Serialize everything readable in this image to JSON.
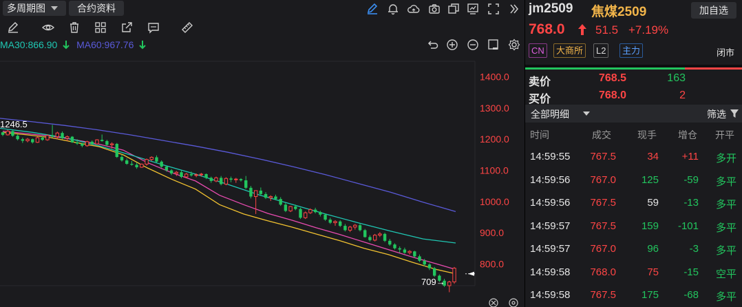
{
  "toolbar": {
    "period_label": "多周期图",
    "contract_label": "合约资料"
  },
  "ma_legend": [
    {
      "label": "MA30:866.90",
      "color": "#1fc7b3",
      "arrow": "down"
    },
    {
      "label": "MA60:967.76",
      "color": "#5a5ad9",
      "arrow": "down"
    }
  ],
  "annotations": {
    "high_label": "1246.5",
    "low_label": "709→"
  },
  "chart_data": {
    "type": "candlestick",
    "y_ticks": [
      "1400.0",
      "1300.0",
      "1200.0",
      "1100.0",
      "1000.0",
      "900.0",
      "800.0"
    ],
    "ylim": [
      730,
      1470
    ],
    "last_price": 768.0,
    "high": 1246.5,
    "low": 709,
    "candles": [
      [
        1222,
        1224,
        1210,
        1214
      ],
      [
        1214,
        1230,
        1212,
        1226
      ],
      [
        1226,
        1228,
        1208,
        1211
      ],
      [
        1211,
        1215,
        1196,
        1200
      ],
      [
        1200,
        1205,
        1188,
        1195
      ],
      [
        1195,
        1204,
        1190,
        1200
      ],
      [
        1200,
        1202,
        1186,
        1190
      ],
      [
        1190,
        1208,
        1188,
        1205
      ],
      [
        1205,
        1210,
        1195,
        1198
      ],
      [
        1198,
        1215,
        1195,
        1212
      ],
      [
        1212,
        1246,
        1205,
        1208
      ],
      [
        1208,
        1224,
        1200,
        1220
      ],
      [
        1220,
        1225,
        1200,
        1203
      ],
      [
        1203,
        1212,
        1194,
        1208
      ],
      [
        1208,
        1210,
        1188,
        1190
      ],
      [
        1190,
        1200,
        1182,
        1186
      ],
      [
        1186,
        1188,
        1174,
        1179
      ],
      [
        1179,
        1195,
        1176,
        1192
      ],
      [
        1192,
        1196,
        1182,
        1185
      ],
      [
        1185,
        1200,
        1183,
        1198
      ],
      [
        1198,
        1215,
        1192,
        1194
      ],
      [
        1194,
        1198,
        1178,
        1182
      ],
      [
        1182,
        1190,
        1170,
        1185
      ],
      [
        1185,
        1188,
        1140,
        1143
      ],
      [
        1143,
        1150,
        1128,
        1132
      ],
      [
        1132,
        1138,
        1118,
        1121
      ],
      [
        1121,
        1130,
        1115,
        1118
      ],
      [
        1118,
        1125,
        1105,
        1110
      ],
      [
        1110,
        1122,
        1108,
        1120
      ],
      [
        1120,
        1138,
        1115,
        1135
      ],
      [
        1135,
        1145,
        1130,
        1142
      ],
      [
        1142,
        1148,
        1125,
        1128
      ],
      [
        1128,
        1132,
        1108,
        1112
      ],
      [
        1112,
        1115,
        1096,
        1100
      ],
      [
        1100,
        1104,
        1085,
        1090
      ],
      [
        1090,
        1098,
        1082,
        1094
      ],
      [
        1094,
        1100,
        1075,
        1079
      ],
      [
        1079,
        1092,
        1075,
        1088
      ],
      [
        1088,
        1096,
        1080,
        1084
      ],
      [
        1084,
        1090,
        1078,
        1086
      ],
      [
        1086,
        1092,
        1080,
        1088
      ],
      [
        1088,
        1090,
        1072,
        1076
      ],
      [
        1076,
        1080,
        1060,
        1066
      ],
      [
        1066,
        1080,
        1062,
        1076
      ],
      [
        1076,
        1082,
        1052,
        1056
      ],
      [
        1056,
        1078,
        1052,
        1074
      ],
      [
        1074,
        1080,
        1062,
        1070
      ],
      [
        1070,
        1076,
        1060,
        1072
      ],
      [
        1072,
        1075,
        1064,
        1068
      ],
      [
        1068,
        1082,
        1040,
        1044
      ],
      [
        1044,
        1050,
        1010,
        1016
      ],
      [
        1016,
        1020,
        960,
        1035
      ],
      [
        1035,
        1045,
        1020,
        1024
      ],
      [
        1024,
        1030,
        1008,
        1012
      ],
      [
        1012,
        1020,
        1002,
        1016
      ],
      [
        1016,
        1022,
        1004,
        1008
      ],
      [
        1008,
        1014,
        986,
        990
      ],
      [
        990,
        996,
        966,
        970
      ],
      [
        970,
        986,
        966,
        984
      ],
      [
        984,
        990,
        972,
        976
      ],
      [
        976,
        980,
        944,
        948
      ],
      [
        948,
        968,
        944,
        964
      ],
      [
        964,
        978,
        960,
        974
      ],
      [
        974,
        980,
        962,
        966
      ],
      [
        966,
        970,
        952,
        958
      ],
      [
        958,
        962,
        938,
        942
      ],
      [
        942,
        948,
        928,
        932
      ],
      [
        932,
        940,
        922,
        936
      ],
      [
        936,
        940,
        918,
        922
      ],
      [
        922,
        928,
        904,
        908
      ],
      [
        908,
        922,
        902,
        918
      ],
      [
        918,
        928,
        910,
        924
      ],
      [
        924,
        930,
        904,
        908
      ],
      [
        908,
        912,
        884,
        886
      ],
      [
        886,
        892,
        872,
        876
      ],
      [
        876,
        896,
        872,
        892
      ],
      [
        892,
        902,
        886,
        896
      ],
      [
        896,
        900,
        870,
        874
      ],
      [
        874,
        880,
        858,
        862
      ],
      [
        862,
        866,
        846,
        850
      ],
      [
        850,
        856,
        836,
        846
      ],
      [
        846,
        852,
        832,
        836
      ],
      [
        836,
        844,
        830,
        840
      ],
      [
        840,
        842,
        820,
        824
      ],
      [
        824,
        830,
        806,
        810
      ],
      [
        810,
        816,
        792,
        798
      ],
      [
        798,
        802,
        780,
        786
      ],
      [
        786,
        790,
        758,
        762
      ],
      [
        762,
        766,
        742,
        746
      ],
      [
        746,
        752,
        726,
        730
      ],
      [
        730,
        746,
        709,
        742
      ],
      [
        742,
        790,
        736,
        786
      ]
    ],
    "ma_lines": [
      {
        "name": "MA5",
        "color": "#f2c230",
        "points": [
          [
            0,
            1222
          ],
          [
            10,
            1214
          ],
          [
            20,
            1205
          ],
          [
            30,
            1190
          ],
          [
            40,
            1176
          ],
          [
            50,
            1150
          ],
          [
            60,
            1108
          ],
          [
            70,
            1072
          ],
          [
            80,
            1040
          ],
          [
            90,
            990
          ],
          [
            100,
            960
          ],
          [
            110,
            938
          ],
          [
            120,
            918
          ],
          [
            130,
            896
          ],
          [
            140,
            874
          ],
          [
            150,
            850
          ],
          [
            160,
            830
          ],
          [
            170,
            805
          ],
          [
            180,
            782
          ],
          [
            188,
            768
          ]
        ]
      },
      {
        "name": "MA10",
        "color": "#e84bb0",
        "points": [
          [
            0,
            1226
          ],
          [
            10,
            1218
          ],
          [
            20,
            1210
          ],
          [
            30,
            1198
          ],
          [
            40,
            1184
          ],
          [
            50,
            1165
          ],
          [
            60,
            1125
          ],
          [
            70,
            1093
          ],
          [
            80,
            1066
          ],
          [
            90,
            1020
          ],
          [
            100,
            990
          ],
          [
            110,
            962
          ],
          [
            120,
            940
          ],
          [
            130,
            916
          ],
          [
            140,
            894
          ],
          [
            150,
            870
          ],
          [
            160,
            846
          ],
          [
            170,
            822
          ],
          [
            180,
            800
          ],
          [
            188,
            782
          ]
        ]
      },
      {
        "name": "MA30",
        "color": "#1fc7b3",
        "points": [
          [
            0,
            1235
          ],
          [
            20,
            1222
          ],
          [
            40,
            1205
          ],
          [
            60,
            1180
          ],
          [
            80,
            1150
          ],
          [
            100,
            1118
          ],
          [
            120,
            1088
          ],
          [
            140,
            1055
          ],
          [
            160,
            1020
          ],
          [
            180,
            990
          ],
          [
            200,
            960
          ],
          [
            220,
            932
          ],
          [
            240,
            905
          ],
          [
            260,
            880
          ],
          [
            280,
            866.9
          ]
        ]
      },
      {
        "name": "MA60",
        "color": "#5a5ad9",
        "points": [
          [
            0,
            1267
          ],
          [
            20,
            1256
          ],
          [
            40,
            1244
          ],
          [
            60,
            1230
          ],
          [
            80,
            1214
          ],
          [
            100,
            1196
          ],
          [
            120,
            1178
          ],
          [
            140,
            1158
          ],
          [
            160,
            1136
          ],
          [
            180,
            1112
          ],
          [
            200,
            1086
          ],
          [
            220,
            1058
          ],
          [
            240,
            1030
          ],
          [
            260,
            998
          ],
          [
            280,
            967.76
          ]
        ]
      }
    ]
  },
  "quote": {
    "code": "jm2509",
    "name": "焦煤2509",
    "add_label": "加自选",
    "price": "768.0",
    "change": "51.5",
    "change_pct": "+7.19%",
    "tags": [
      "CN",
      "大商所",
      "L2",
      "主力"
    ],
    "status": "闭市"
  },
  "orderbook": {
    "ask_label": "卖价",
    "ask_price": "768.5",
    "ask_vol": "163",
    "bid_label": "买价",
    "bid_price": "768.0",
    "bid_vol": "2"
  },
  "details": {
    "title": "全部明细",
    "filter_label": "筛选",
    "columns": [
      "时间",
      "成交",
      "现手",
      "增仓",
      "开平"
    ],
    "rows": [
      {
        "time": "14:59:55",
        "price": "767.5",
        "vol": "34",
        "vol_color": "red",
        "oi": "+11",
        "oi_color": "red",
        "type": "多开",
        "type_color": "green"
      },
      {
        "time": "14:59:56",
        "price": "767.0",
        "vol": "125",
        "vol_color": "green",
        "oi": "-59",
        "oi_color": "green",
        "type": "多平",
        "type_color": "green"
      },
      {
        "time": "14:59:56",
        "price": "767.5",
        "vol": "59",
        "vol_color": "white",
        "oi": "-13",
        "oi_color": "green",
        "type": "多平",
        "type_color": "green"
      },
      {
        "time": "14:59:57",
        "price": "767.5",
        "vol": "159",
        "vol_color": "green",
        "oi": "-101",
        "oi_color": "green",
        "type": "多平",
        "type_color": "green"
      },
      {
        "time": "14:59:57",
        "price": "767.0",
        "vol": "96",
        "vol_color": "green",
        "oi": "-3",
        "oi_color": "green",
        "type": "多平",
        "type_color": "green"
      },
      {
        "time": "14:59:58",
        "price": "768.0",
        "vol": "75",
        "vol_color": "red",
        "oi": "-15",
        "oi_color": "green",
        "type": "空平",
        "type_color": "green"
      },
      {
        "time": "14:59:58",
        "price": "767.5",
        "vol": "175",
        "vol_color": "green",
        "oi": "-68",
        "oi_color": "green",
        "type": "多平",
        "type_color": "green"
      }
    ]
  }
}
